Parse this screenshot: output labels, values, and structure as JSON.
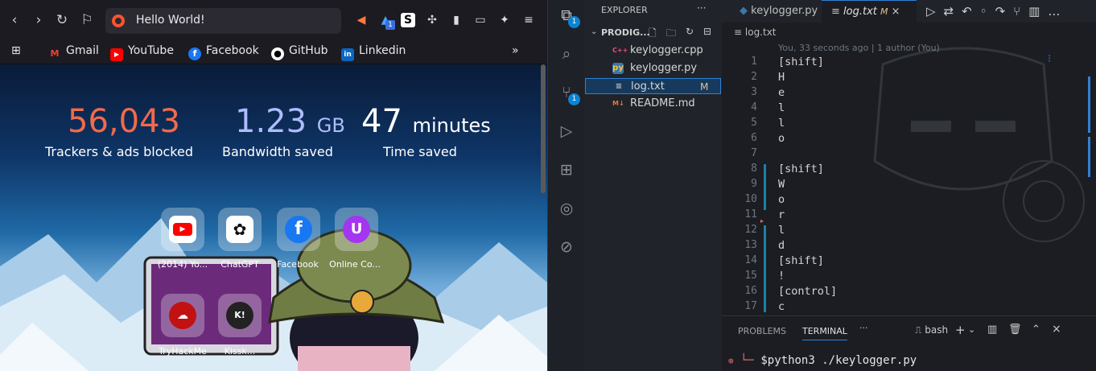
{
  "browser": {
    "url_text": "Hello World!",
    "bookmarks": [
      {
        "label": "Gmail",
        "icon": "gmail-icon",
        "color": "#ea4335"
      },
      {
        "label": "YouTube",
        "icon": "youtube-icon",
        "color": "#ff0000"
      },
      {
        "label": "Facebook",
        "icon": "facebook-icon",
        "color": "#1877f2"
      },
      {
        "label": "GitHub",
        "icon": "github-icon",
        "color": "#ffffff"
      },
      {
        "label": "Linkedin",
        "icon": "linkedin-icon",
        "color": "#0a66c2"
      }
    ],
    "extension_badge": "1",
    "stats": [
      {
        "value": "56,043",
        "unit": "",
        "label": "Trackers & ads blocked",
        "color": "#f26a4b"
      },
      {
        "value": "1.23",
        "unit": "GB",
        "label": "Bandwidth saved",
        "color": "#aebcff"
      },
      {
        "value": "47",
        "unit": "minutes",
        "label": "Time saved",
        "color": "#ffffff"
      }
    ],
    "top_sites": [
      {
        "label": "(2014) Yo...",
        "icon": "youtube-icon",
        "color": "#ff0000"
      },
      {
        "label": "ChatGPT",
        "icon": "chatgpt-icon",
        "color": "#ffffff"
      },
      {
        "label": "Facebook",
        "icon": "facebook-icon",
        "color": "#1877f2"
      },
      {
        "label": "Online Co...",
        "icon": "udemy-icon",
        "color": "#a435f0"
      },
      {
        "label": "TryHackMe",
        "icon": "tryhackme-icon",
        "color": "#c11111"
      },
      {
        "label": "Kissk...",
        "icon": "kiss-icon",
        "color": "#222222"
      }
    ]
  },
  "vscode": {
    "explorer_title": "EXPLORER",
    "folder": "PRODIG...",
    "files": [
      {
        "name": "keylogger.cpp",
        "icon": "cpp-file-icon",
        "icon_text": "C++",
        "color": "#f34b7d",
        "badge": ""
      },
      {
        "name": "keylogger.py",
        "icon": "python-file-icon",
        "icon_text": "py",
        "color": "#3b77a8",
        "badge": ""
      },
      {
        "name": "log.txt",
        "icon": "text-file-icon",
        "icon_text": "≡",
        "color": "#c8c8c8",
        "badge": "M"
      },
      {
        "name": "README.md",
        "icon": "markdown-file-icon",
        "icon_text": "M↓",
        "color": "#e37933",
        "badge": ""
      }
    ],
    "tabs": [
      {
        "label": "keylogger.py",
        "modified": ""
      },
      {
        "label": "log.txt",
        "modified": "M"
      }
    ],
    "breadcrumb": "log.txt",
    "blame": "You, 33 seconds ago | 1 author (You)",
    "lines": [
      "[shift]",
      "H",
      "e",
      "l",
      "l",
      "o",
      "",
      "[shift]",
      "W",
      "o",
      "r",
      "l",
      "d",
      "[shift]",
      "!",
      "[control]",
      "c"
    ],
    "line_numbers": [
      "1",
      "2",
      "3",
      "4",
      "5",
      "6",
      "7",
      "8",
      "9",
      "10",
      "11",
      "12",
      "13",
      "14",
      "15",
      "16",
      "17"
    ],
    "panel_tabs": [
      "PROBLEMS",
      "TERMINAL"
    ],
    "terminal_shell": "bash",
    "terminal_prompt": "$python3 ./keylogger.py",
    "badges": {
      "explorer": "1",
      "scm": "1"
    }
  }
}
